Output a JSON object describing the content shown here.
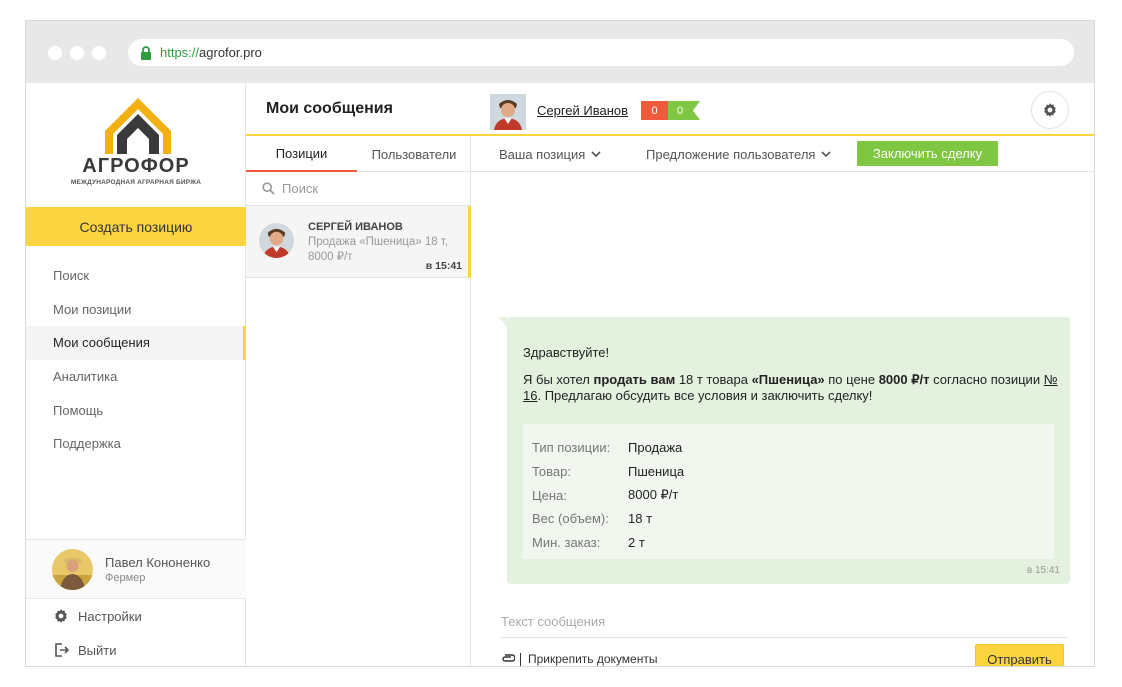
{
  "browser": {
    "url_scheme": "https://",
    "url_host": "agrofor.pro"
  },
  "logo": {
    "wordmark": "АГРОФОР",
    "tagline": "Международная аграрная биржа"
  },
  "sidebar": {
    "create_label": "Создать позицию",
    "items": [
      {
        "label": "Поиск"
      },
      {
        "label": "Мои позиции"
      },
      {
        "label": "Мои сообщения",
        "active": true
      },
      {
        "label": "Аналитика"
      },
      {
        "label": "Помощь"
      },
      {
        "label": "Поддержка"
      }
    ],
    "user": {
      "name": "Павел Кононенко",
      "role": "Фермер"
    },
    "settings_label": "Настройки",
    "logout_label": "Выйти"
  },
  "header": {
    "title": "Мои сообщения",
    "contact_name": "Сергей Иванов",
    "score_negative": "0",
    "score_positive": "0"
  },
  "conversations": {
    "tabs": [
      {
        "label": "Позиции",
        "active": true
      },
      {
        "label": "Пользователи",
        "active": false
      }
    ],
    "search_placeholder": "Поиск",
    "items": [
      {
        "name": "СЕРГЕЙ ИВАНОВ",
        "preview": "Продажа «Пшеница» 18 т, 8000 ₽/т",
        "time": "в 15:41"
      }
    ]
  },
  "chat_toolbar": {
    "your_position_label": "Ваша позиция",
    "user_offer_label": "Предложение пользователя",
    "deal_label": "Заключить сделку"
  },
  "message": {
    "greeting": "Здравствуйте!",
    "body_parts": {
      "p1": "Я бы хотел ",
      "b1": "продать вам",
      "p2": " 18 т товара ",
      "b2": "«Пшеница»",
      "p3": " по цене ",
      "b3": "8000 ₽/т",
      "p4": " согласно позиции ",
      "link": "№ 16",
      "p5": ". Предлагаю обсудить все условия и заключить сделку!"
    },
    "details": [
      {
        "label": "Тип позиции:",
        "value": "Продажа"
      },
      {
        "label": "Товар:",
        "value": "Пшеница"
      },
      {
        "label": "Цена:",
        "value": "8000 ₽/т"
      },
      {
        "label": "Вес (объем):",
        "value": "18 т"
      },
      {
        "label": "Мин. заказ:",
        "value": "2 т"
      }
    ],
    "time": "в 15:41"
  },
  "compose": {
    "placeholder": "Текст сообщения",
    "attach_label": "Прикрепить документы",
    "send_label": "Отправить"
  },
  "colors": {
    "accent_yellow": "#fad53f",
    "accent_green": "#7fc642",
    "accent_red": "#f05a3a",
    "bubble_bg": "#e4f1df"
  }
}
